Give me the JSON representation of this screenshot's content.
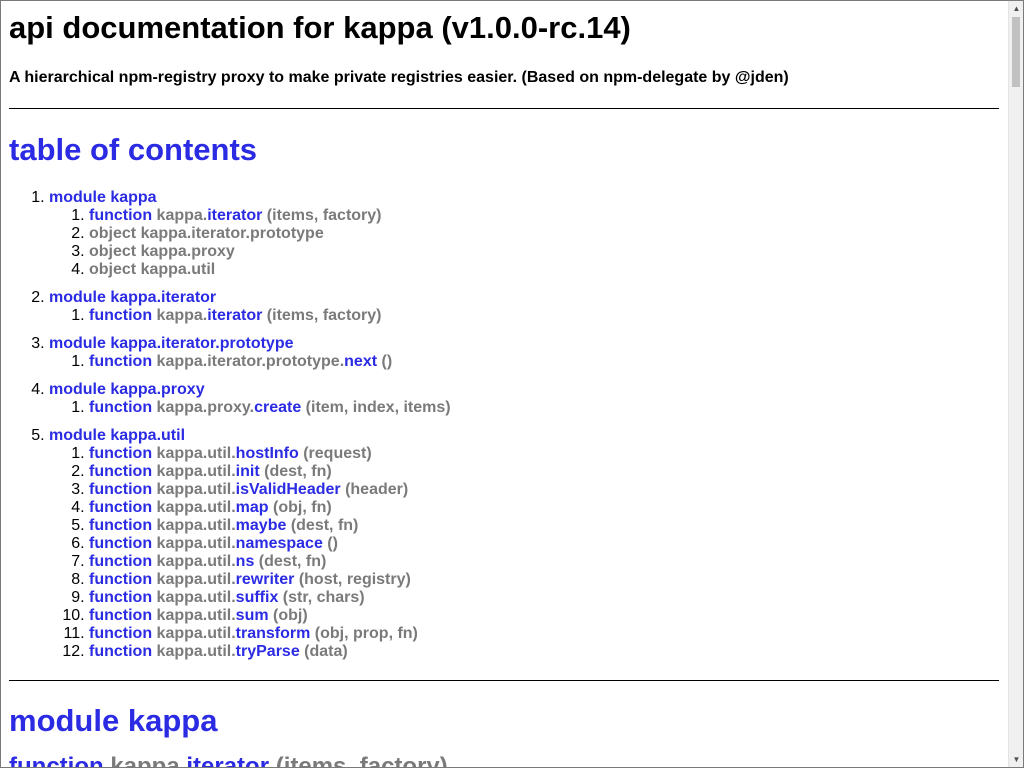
{
  "title": "api documentation for kappa (v1.0.0-rc.14)",
  "description": "A hierarchical npm-registry proxy to make private registries easier. (Based on npm-delegate by @jden)",
  "toc": {
    "heading": "table of contents",
    "modules": [
      {
        "name": "module kappa",
        "members": [
          {
            "kw": "function",
            "path": "kappa.",
            "fn": "iterator",
            "args": " (items, factory)"
          },
          {
            "kw": "",
            "path": "object kappa.iterator.prototype",
            "fn": "",
            "args": ""
          },
          {
            "kw": "",
            "path": "object kappa.proxy",
            "fn": "",
            "args": ""
          },
          {
            "kw": "",
            "path": "object kappa.util",
            "fn": "",
            "args": ""
          }
        ]
      },
      {
        "name": "module kappa.iterator",
        "members": [
          {
            "kw": "function",
            "path": "kappa.",
            "fn": "iterator",
            "args": " (items, factory)"
          }
        ]
      },
      {
        "name": "module kappa.iterator.prototype",
        "members": [
          {
            "kw": "function",
            "path": "kappa.iterator.prototype.",
            "fn": "next",
            "args": " ()"
          }
        ]
      },
      {
        "name": "module kappa.proxy",
        "members": [
          {
            "kw": "function",
            "path": "kappa.proxy.",
            "fn": "create",
            "args": " (item, index, items)"
          }
        ]
      },
      {
        "name": "module kappa.util",
        "members": [
          {
            "kw": "function",
            "path": "kappa.util.",
            "fn": "hostInfo",
            "args": " (request)"
          },
          {
            "kw": "function",
            "path": "kappa.util.",
            "fn": "init",
            "args": " (dest, fn)"
          },
          {
            "kw": "function",
            "path": "kappa.util.",
            "fn": "isValidHeader",
            "args": " (header)"
          },
          {
            "kw": "function",
            "path": "kappa.util.",
            "fn": "map",
            "args": " (obj, fn)"
          },
          {
            "kw": "function",
            "path": "kappa.util.",
            "fn": "maybe",
            "args": " (dest, fn)"
          },
          {
            "kw": "function",
            "path": "kappa.util.",
            "fn": "namespace",
            "args": " ()"
          },
          {
            "kw": "function",
            "path": "kappa.util.",
            "fn": "ns",
            "args": " (dest, fn)"
          },
          {
            "kw": "function",
            "path": "kappa.util.",
            "fn": "rewriter",
            "args": " (host, registry)"
          },
          {
            "kw": "function",
            "path": "kappa.util.",
            "fn": "suffix",
            "args": " (str, chars)"
          },
          {
            "kw": "function",
            "path": "kappa.util.",
            "fn": "sum",
            "args": " (obj)"
          },
          {
            "kw": "function",
            "path": "kappa.util.",
            "fn": "transform",
            "args": " (obj, prop, fn)"
          },
          {
            "kw": "function",
            "path": "kappa.util.",
            "fn": "tryParse",
            "args": " (data)"
          }
        ]
      }
    ]
  },
  "section": {
    "heading": "module kappa",
    "first_entry": {
      "kw": "function",
      "path": "kappa.",
      "fn": "iterator",
      "args": " (items, factory)"
    }
  },
  "colors": {
    "link": "#2b2be4",
    "muted": "#7a7a7a"
  },
  "scrollbar": {
    "up_icon": "arrow-up-icon",
    "down_icon": "arrow-down-icon"
  }
}
